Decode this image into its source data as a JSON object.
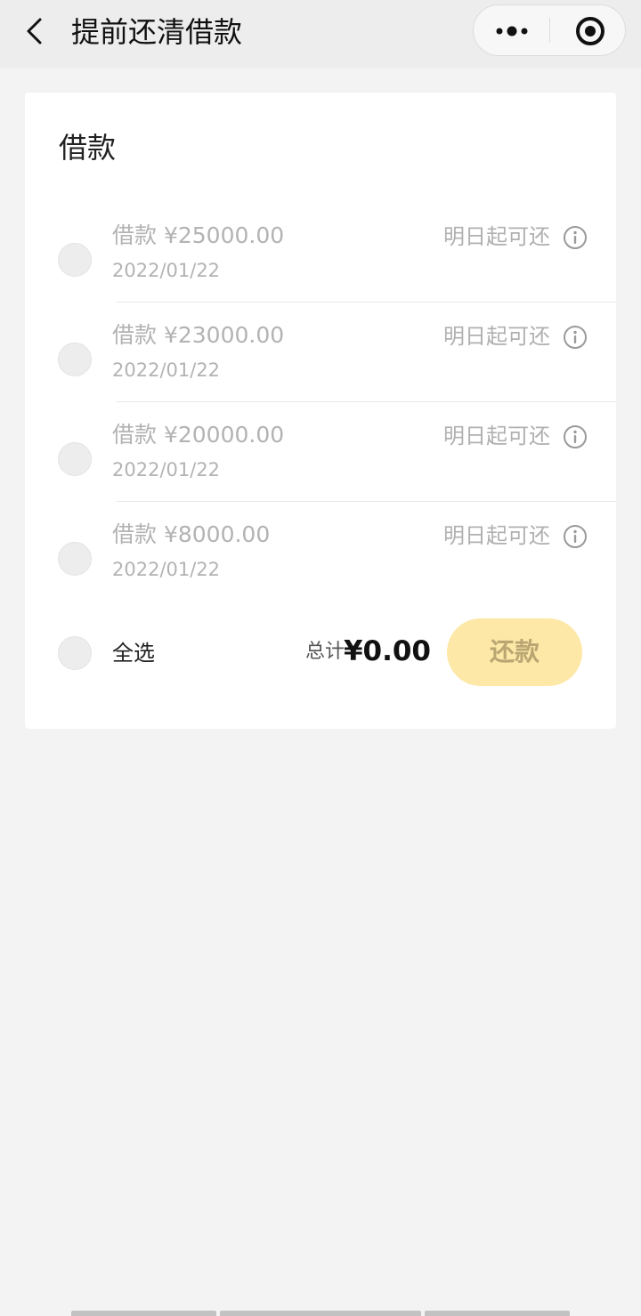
{
  "nav": {
    "title": "提前还清借款",
    "back_icon": "chevron-left-icon",
    "more_icon": "more-dots-icon",
    "close_icon": "target-circle-icon"
  },
  "card": {
    "title": "借款",
    "loans": [
      {
        "amount": "借款 ¥25000.00",
        "date": "2022/01/22",
        "status": "明日起可还"
      },
      {
        "amount": "借款 ¥23000.00",
        "date": "2022/01/22",
        "status": "明日起可还"
      },
      {
        "amount": "借款 ¥20000.00",
        "date": "2022/01/22",
        "status": "明日起可还"
      },
      {
        "amount": "借款 ¥8000.00",
        "date": "2022/01/22",
        "status": "明日起可还"
      }
    ],
    "select_all_label": "全选",
    "total_label": "总计",
    "total_value": "¥0.00",
    "repay_label": "还款"
  },
  "colors": {
    "page_bg": "#f3f3f3",
    "nav_bg": "#ededed",
    "button_bg": "#fde8a8",
    "button_text": "#b9a672",
    "muted_text": "#b3b3b3"
  }
}
